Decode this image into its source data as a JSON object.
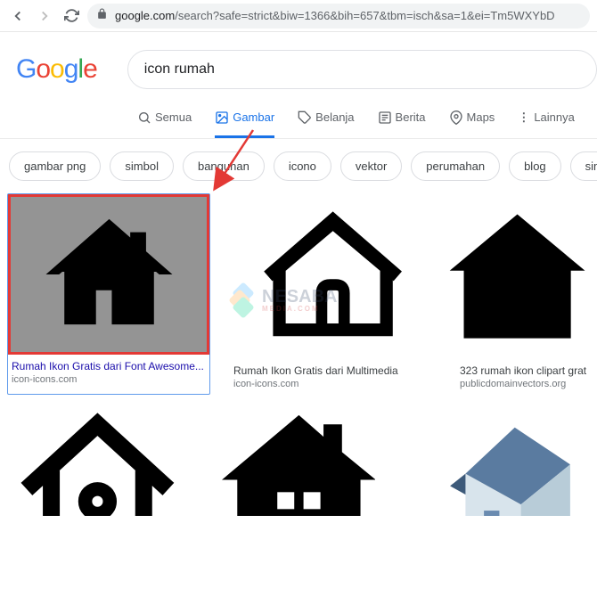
{
  "browser": {
    "url_domain": "google.com",
    "url_path": "/search?safe=strict&biw=1366&bih=657&tbm=isch&sa=1&ei=Tm5WXYbD"
  },
  "logo": {
    "g1": "G",
    "o1": "o",
    "o2": "o",
    "g2": "g",
    "l": "l",
    "e": "e"
  },
  "search": {
    "query": "icon rumah"
  },
  "tabs": {
    "all": "Semua",
    "images": "Gambar",
    "shopping": "Belanja",
    "news": "Berita",
    "maps": "Maps",
    "more": "Lainnya"
  },
  "chips": [
    "gambar png",
    "simbol",
    "bangunan",
    "icono",
    "vektor",
    "perumahan",
    "blog",
    "sim"
  ],
  "results": [
    {
      "title": "Rumah Ikon Gratis dari Font Awesome...",
      "source": "icon-icons.com"
    },
    {
      "title": "Rumah Ikon Gratis dari Multimedia",
      "source": "icon-icons.com"
    },
    {
      "title": "323 rumah ikon clipart grat",
      "source": "publicdomainvectors.org"
    }
  ],
  "watermark": {
    "name": "NESABA",
    "sub": "MEDIA.COM"
  }
}
